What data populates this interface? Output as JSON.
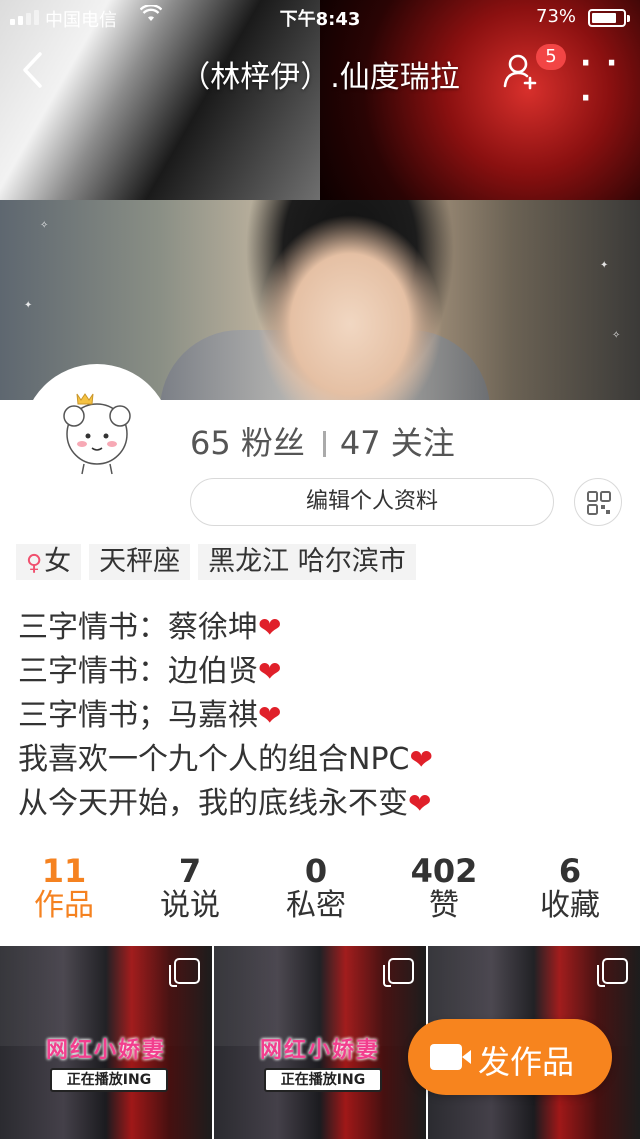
{
  "status_bar": {
    "carrier": "中国电信",
    "time": "下午8:43",
    "battery": "73%"
  },
  "nav": {
    "title": "（林梓伊）.仙度瑞拉",
    "follow_badge": "5"
  },
  "profile": {
    "fans_count": "65",
    "fans_label": "粉丝",
    "following_count": "47",
    "following_label": "关注",
    "edit_button": "编辑个人资料",
    "tags": [
      "女",
      "天秤座",
      "黑龙江 哈尔滨市"
    ],
    "bio": [
      "三字情书：蔡徐坤",
      "三字情书：边伯贤",
      "三字情书；马嘉祺",
      "我喜欢一个九个人的组合NPC",
      "从今天开始，我的底线永不变"
    ]
  },
  "counts": [
    {
      "num": "11",
      "label": "作品"
    },
    {
      "num": "7",
      "label": "说说"
    },
    {
      "num": "0",
      "label": "私密"
    },
    {
      "num": "402",
      "label": "赞"
    },
    {
      "num": "6",
      "label": "收藏"
    }
  ],
  "works": [
    {
      "title": "网红小娇妻",
      "sub": "正在播放ING"
    },
    {
      "title": "网红小娇妻",
      "sub": "正在播放ING"
    },
    {
      "title": "",
      "sub": ""
    }
  ],
  "publish_button": "发作品",
  "colors": {
    "accent": "#f7841e",
    "badge": "#f24545",
    "heart": "#e0202a"
  }
}
